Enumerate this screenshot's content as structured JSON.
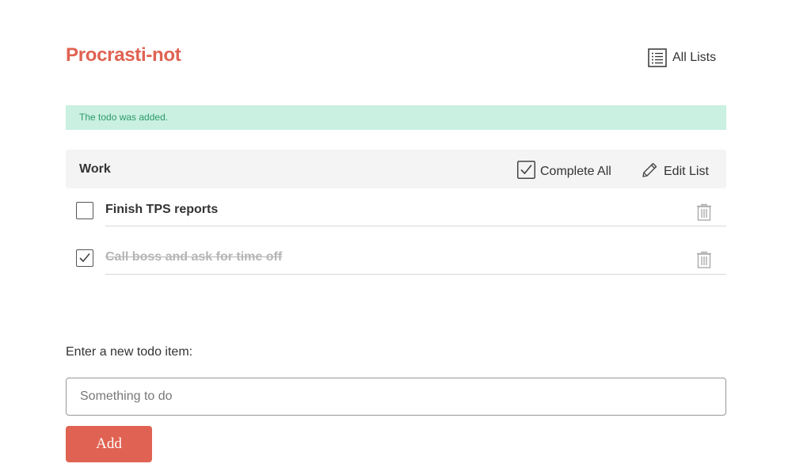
{
  "app": {
    "title": "Procrasti-not"
  },
  "nav": {
    "all_lists_label": "All Lists",
    "all_lists_icon": "list-icon"
  },
  "flash": {
    "message": "The todo was added."
  },
  "list": {
    "name": "Work",
    "complete_all_label": "Complete All",
    "edit_list_label": "Edit List",
    "todos": [
      {
        "text": "Finish TPS reports",
        "completed": false
      },
      {
        "text": "Call boss and ask for time off",
        "completed": true
      }
    ]
  },
  "new_todo": {
    "label": "Enter a new todo item:",
    "placeholder": "Something to do",
    "value": "",
    "submit_label": "Add"
  },
  "colors": {
    "accent": "#e06252",
    "flash_bg": "#c9f0e1",
    "flash_text": "#2d9a6a",
    "header_bg": "#f4f4f4",
    "completed_text": "#b5b5b5"
  }
}
